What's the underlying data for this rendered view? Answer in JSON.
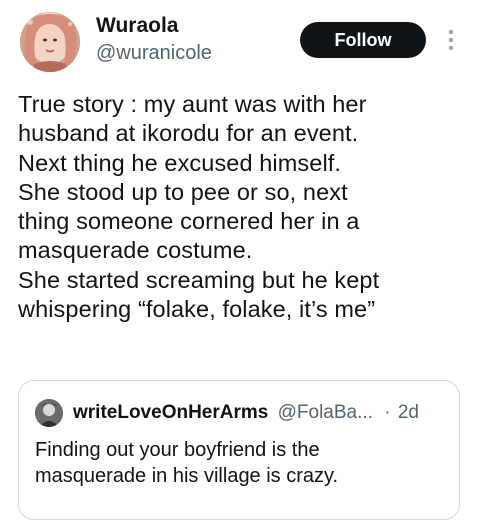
{
  "tweet": {
    "author": {
      "display_name": "Wuraola",
      "handle": "@wuranicole"
    },
    "follow_label": "Follow",
    "more_icon": "more-vertical-icon",
    "text": "True story : my aunt was with her\nhusband at ikorodu for an event.\nNext thing he excused himself.\nShe stood up to pee or so, next\nthing someone cornered her in a\nmasquerade costume.\nShe started screaming but he kept\nwhispering “folake, folake, it’s me”"
  },
  "quoted_tweet": {
    "display_name": "writeLoveOnHerArms",
    "handle": "@FolaBa...",
    "separator": "·",
    "time": "2d",
    "text": "Finding out your boyfriend is the\nmasquerade in his village is crazy."
  },
  "colors": {
    "text_primary": "#0f1419",
    "text_secondary": "#536471",
    "button_bg": "#0f1419",
    "border": "#cfd9de"
  }
}
